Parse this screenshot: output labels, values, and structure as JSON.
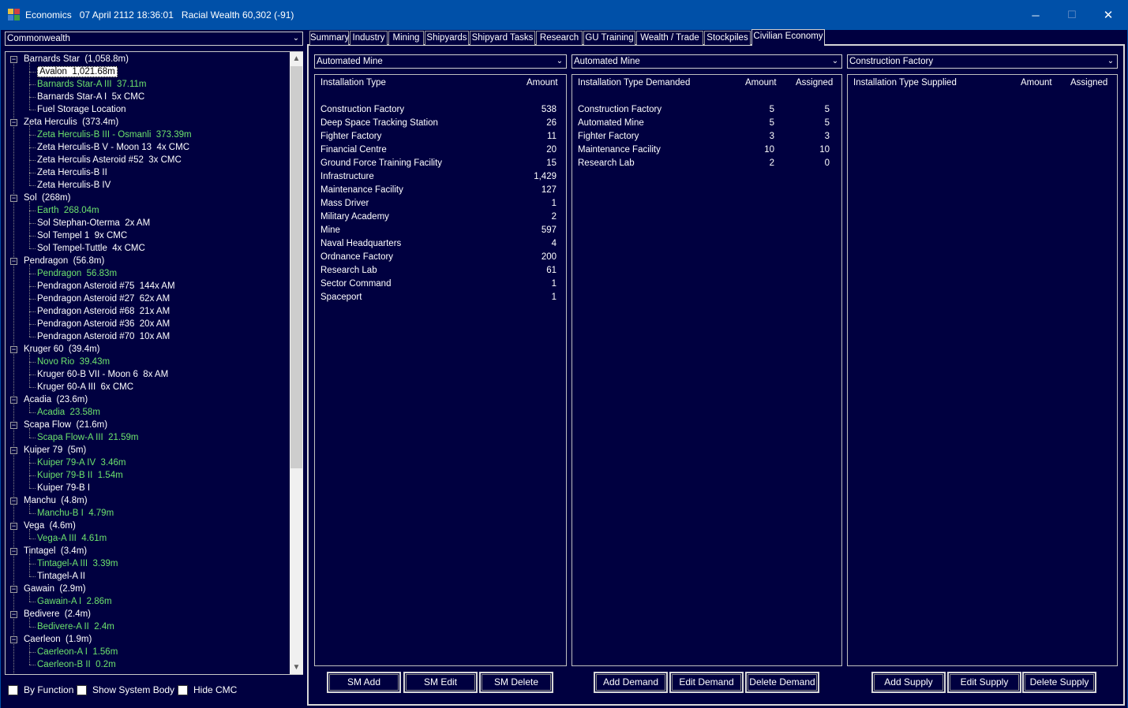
{
  "window": {
    "title": "Economics   07 April 2112 18:36:01   Racial Wealth 60,302 (-91)",
    "minimize": "─",
    "maximize": "☐",
    "close": "✕"
  },
  "empire_select": {
    "value": "Commonwealth"
  },
  "tree": {
    "items": [
      {
        "label": "Barnards Star  (1,058.8m)",
        "level": 0,
        "green": false
      },
      {
        "label": "Avalon  1,021.68m",
        "level": 1,
        "green": false,
        "selected": true
      },
      {
        "label": "Barnards Star-A III  37.11m",
        "level": 1,
        "green": true
      },
      {
        "label": "Barnards Star-A I  5x CMC",
        "level": 1,
        "green": false
      },
      {
        "label": "Fuel Storage Location",
        "level": 1,
        "green": false
      },
      {
        "label": "Zeta Herculis  (373.4m)",
        "level": 0,
        "green": false
      },
      {
        "label": "Zeta Herculis-B III - Osmanli  373.39m",
        "level": 1,
        "green": true
      },
      {
        "label": "Zeta Herculis-B V - Moon 13  4x CMC",
        "level": 1,
        "green": false
      },
      {
        "label": "Zeta Herculis Asteroid #52  3x CMC",
        "level": 1,
        "green": false
      },
      {
        "label": "Zeta Herculis-B II",
        "level": 1,
        "green": false
      },
      {
        "label": "Zeta Herculis-B IV",
        "level": 1,
        "green": false
      },
      {
        "label": "Sol  (268m)",
        "level": 0,
        "green": false
      },
      {
        "label": "Earth  268.04m",
        "level": 1,
        "green": true
      },
      {
        "label": "Sol Stephan-Oterma  2x AM",
        "level": 1,
        "green": false
      },
      {
        "label": "Sol Tempel 1  9x CMC",
        "level": 1,
        "green": false
      },
      {
        "label": "Sol Tempel-Tuttle  4x CMC",
        "level": 1,
        "green": false
      },
      {
        "label": "Pendragon  (56.8m)",
        "level": 0,
        "green": false
      },
      {
        "label": "Pendragon  56.83m",
        "level": 1,
        "green": true
      },
      {
        "label": "Pendragon Asteroid #75  144x AM",
        "level": 1,
        "green": false
      },
      {
        "label": "Pendragon Asteroid #27  62x AM",
        "level": 1,
        "green": false
      },
      {
        "label": "Pendragon Asteroid #68  21x AM",
        "level": 1,
        "green": false
      },
      {
        "label": "Pendragon Asteroid #36  20x AM",
        "level": 1,
        "green": false
      },
      {
        "label": "Pendragon Asteroid #70  10x AM",
        "level": 1,
        "green": false
      },
      {
        "label": "Kruger 60  (39.4m)",
        "level": 0,
        "green": false
      },
      {
        "label": "Novo Rio  39.43m",
        "level": 1,
        "green": true
      },
      {
        "label": "Kruger 60-B VII - Moon 6  8x AM",
        "level": 1,
        "green": false
      },
      {
        "label": "Kruger 60-A III  6x CMC",
        "level": 1,
        "green": false
      },
      {
        "label": "Acadia  (23.6m)",
        "level": 0,
        "green": false
      },
      {
        "label": "Acadia  23.58m",
        "level": 1,
        "green": true
      },
      {
        "label": "Scapa Flow  (21.6m)",
        "level": 0,
        "green": false
      },
      {
        "label": "Scapa Flow-A III  21.59m",
        "level": 1,
        "green": true
      },
      {
        "label": "Kuiper 79  (5m)",
        "level": 0,
        "green": false
      },
      {
        "label": "Kuiper 79-A IV  3.46m",
        "level": 1,
        "green": true
      },
      {
        "label": "Kuiper 79-B II  1.54m",
        "level": 1,
        "green": true
      },
      {
        "label": "Kuiper 79-B I",
        "level": 1,
        "green": false
      },
      {
        "label": "Manchu  (4.8m)",
        "level": 0,
        "green": false
      },
      {
        "label": "Manchu-B I  4.79m",
        "level": 1,
        "green": true
      },
      {
        "label": "Vega  (4.6m)",
        "level": 0,
        "green": false
      },
      {
        "label": "Vega-A III  4.61m",
        "level": 1,
        "green": true
      },
      {
        "label": "Tintagel  (3.4m)",
        "level": 0,
        "green": false
      },
      {
        "label": "Tintagel-A III  3.39m",
        "level": 1,
        "green": true
      },
      {
        "label": "Tintagel-A II",
        "level": 1,
        "green": false
      },
      {
        "label": "Gawain  (2.9m)",
        "level": 0,
        "green": false
      },
      {
        "label": "Gawain-A I  2.86m",
        "level": 1,
        "green": true
      },
      {
        "label": "Bedivere  (2.4m)",
        "level": 0,
        "green": false
      },
      {
        "label": "Bedivere-A II  2.4m",
        "level": 1,
        "green": true
      },
      {
        "label": "Caerleon  (1.9m)",
        "level": 0,
        "green": false
      },
      {
        "label": "Caerleon-A I  1.56m",
        "level": 1,
        "green": true
      },
      {
        "label": "Caerleon-B II  0.2m",
        "level": 1,
        "green": true
      }
    ],
    "expander_symbol": "−"
  },
  "checkboxes": [
    {
      "label": "By Function",
      "checked": false
    },
    {
      "label": "Show System Body",
      "checked": false
    },
    {
      "label": "Hide CMC",
      "checked": false
    }
  ],
  "tabs": [
    {
      "label": "Summary",
      "active": false
    },
    {
      "label": "Industry",
      "active": false
    },
    {
      "label": "Mining",
      "active": false
    },
    {
      "label": "Shipyards",
      "active": false
    },
    {
      "label": "Shipyard Tasks",
      "active": false
    },
    {
      "label": "Research",
      "active": false
    },
    {
      "label": "GU Training",
      "active": false
    },
    {
      "label": "Wealth / Trade",
      "active": false
    },
    {
      "label": "Stockpiles",
      "active": false
    },
    {
      "label": "Civilian Economy",
      "active": true
    }
  ],
  "panel1": {
    "combo": "Automated Mine",
    "headers": {
      "type": "Installation Type",
      "amount": "Amount"
    },
    "rows": [
      {
        "type": "Construction Factory",
        "amount": "538"
      },
      {
        "type": "Deep Space Tracking Station",
        "amount": "26"
      },
      {
        "type": "Fighter Factory",
        "amount": "11"
      },
      {
        "type": "Financial Centre",
        "amount": "20"
      },
      {
        "type": "Ground Force Training Facility",
        "amount": "15"
      },
      {
        "type": "Infrastructure",
        "amount": "1,429"
      },
      {
        "type": "Maintenance Facility",
        "amount": "127"
      },
      {
        "type": "Mass Driver",
        "amount": "1"
      },
      {
        "type": "Military Academy",
        "amount": "2"
      },
      {
        "type": "Mine",
        "amount": "597"
      },
      {
        "type": "Naval Headquarters",
        "amount": "4"
      },
      {
        "type": "Ordnance Factory",
        "amount": "200"
      },
      {
        "type": "Research Lab",
        "amount": "61"
      },
      {
        "type": "Sector Command",
        "amount": "1"
      },
      {
        "type": "Spaceport",
        "amount": "1"
      }
    ],
    "buttons": [
      "SM Add",
      "SM Edit",
      "SM Delete"
    ]
  },
  "panel2": {
    "combo": "Automated Mine",
    "headers": {
      "type": "Installation Type Demanded",
      "amount": "Amount",
      "assigned": "Assigned"
    },
    "rows": [
      {
        "type": "Construction Factory",
        "amount": "5",
        "assigned": "5"
      },
      {
        "type": "Automated Mine",
        "amount": "5",
        "assigned": "5"
      },
      {
        "type": "Fighter Factory",
        "amount": "3",
        "assigned": "3"
      },
      {
        "type": "Maintenance Facility",
        "amount": "10",
        "assigned": "10"
      },
      {
        "type": "Research Lab",
        "amount": "2",
        "assigned": "0"
      }
    ],
    "buttons": [
      "Add Demand",
      "Edit Demand",
      "Delete Demand"
    ]
  },
  "panel3": {
    "combo": "Construction Factory",
    "headers": {
      "type": "Installation Type Supplied",
      "amount": "Amount",
      "assigned": "Assigned"
    },
    "rows": [],
    "buttons": [
      "Add Supply",
      "Edit Supply",
      "Delete Supply"
    ]
  },
  "icons": {
    "dropdown": "chevron-down-icon",
    "scroll_up": "scroll-up-icon",
    "scroll_down": "scroll-down-icon"
  }
}
